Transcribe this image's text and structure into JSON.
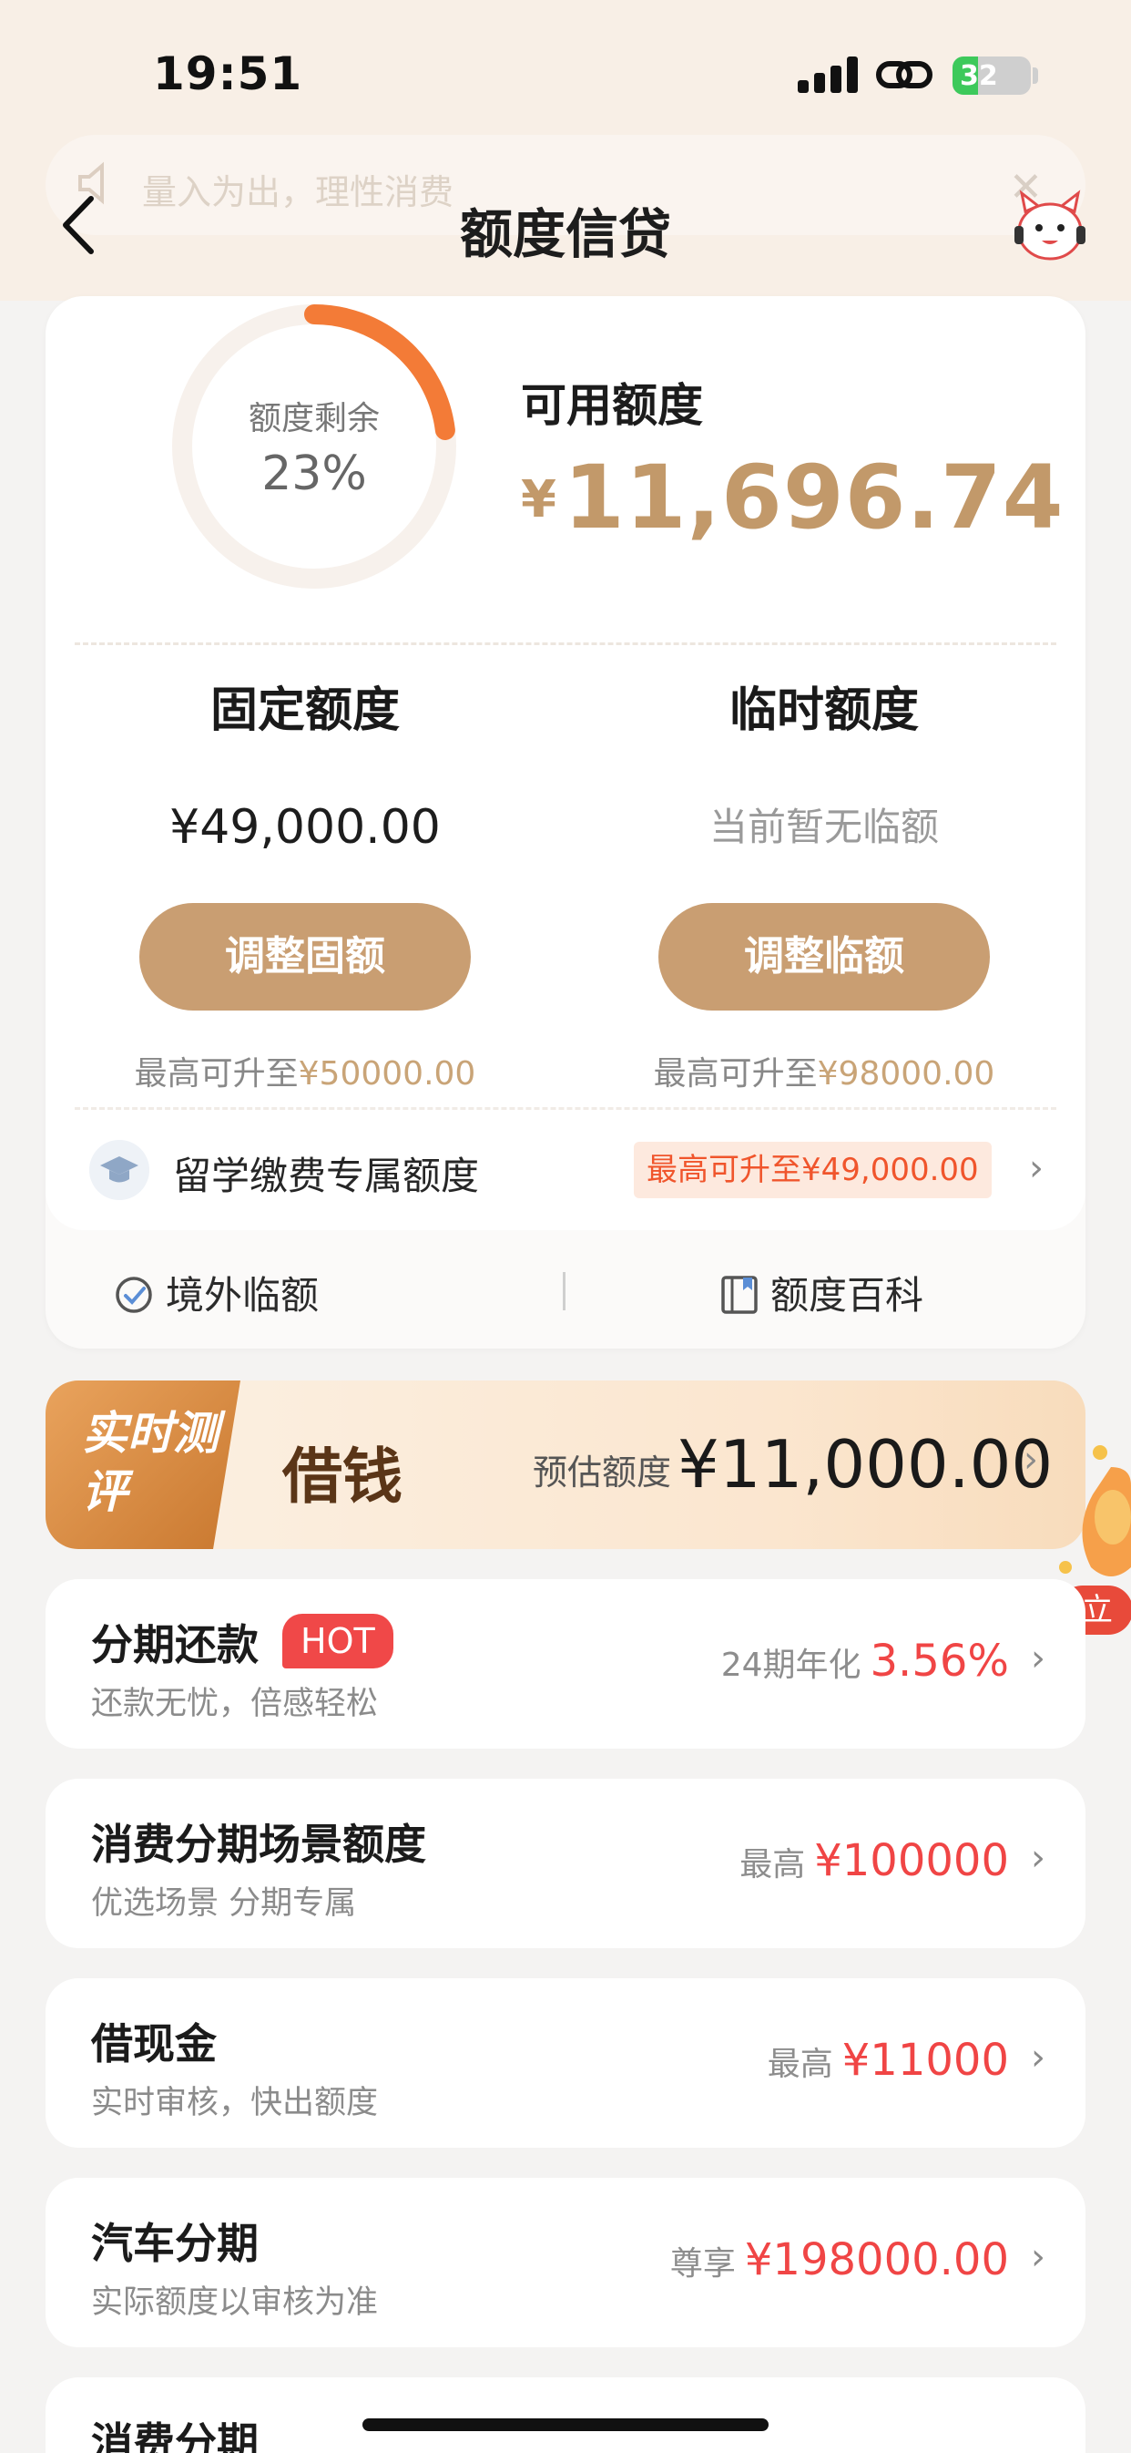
{
  "status_bar": {
    "time": "19:51",
    "battery": "32"
  },
  "notice": {
    "text": "量入为出，理性消费"
  },
  "nav": {
    "title": "额度信贷"
  },
  "credit": {
    "ring_label": "额度剩余",
    "ring_percent": "23%",
    "remaining_fraction": 0.23,
    "available_label": "可用额度",
    "currency": "¥",
    "available_amount": "11,696.74"
  },
  "fixed": {
    "title": "固定额度",
    "value": "¥49,000.00",
    "button": "调整固额",
    "hint_prefix": "最高可升至",
    "hint_value": "¥50000.00"
  },
  "temp": {
    "title": "临时额度",
    "value": "当前暂无临额",
    "button": "调整临额",
    "hint_prefix": "最高可升至",
    "hint_value": "¥98000.00"
  },
  "study": {
    "label": "留学缴费专属额度",
    "badge": "最高可升至¥49,000.00"
  },
  "quick": {
    "overseas": "境外临额",
    "wiki": "额度百科"
  },
  "banner": {
    "tag": "实时测评",
    "title": "借钱",
    "est_label": "预估额度",
    "amount": "¥11,000.00"
  },
  "list": [
    {
      "title": "分期还款",
      "badge": "HOT",
      "sub": "还款无忧，倍感轻松",
      "pre": "24期年化",
      "value": "3.56%"
    },
    {
      "title": "消费分期场景额度",
      "sub": "优选场景 分期专属",
      "pre": "最高",
      "value": "¥100000"
    },
    {
      "title": "借现金",
      "sub": "实时审核，快出额度",
      "pre": "最高",
      "value": "¥11000"
    },
    {
      "title": "汽车分期",
      "sub": "实际额度以审核为准",
      "pre": "尊享",
      "value": "¥198000.00"
    },
    {
      "title": "消费分期",
      "sub": "",
      "pre": "",
      "value": ""
    }
  ],
  "promo": {
    "label": "立"
  },
  "colors": {
    "gold": "#c2996a",
    "button": "#c99e72",
    "accent": "#f37b37",
    "red": "#f04545"
  }
}
